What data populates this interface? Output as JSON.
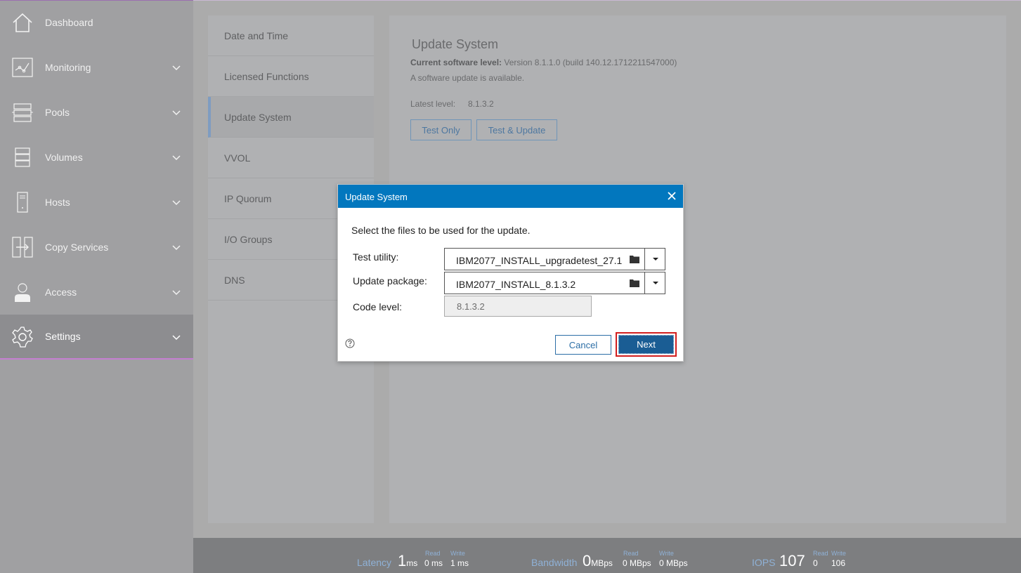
{
  "sidebar": {
    "items": [
      {
        "label": "Dashboard",
        "icon": "home-icon"
      },
      {
        "label": "Monitoring",
        "icon": "monitoring-icon"
      },
      {
        "label": "Pools",
        "icon": "pools-icon"
      },
      {
        "label": "Volumes",
        "icon": "volumes-icon"
      },
      {
        "label": "Hosts",
        "icon": "hosts-icon"
      },
      {
        "label": "Copy Services",
        "icon": "copy-services-icon"
      },
      {
        "label": "Access",
        "icon": "access-icon"
      },
      {
        "label": "Settings",
        "icon": "gear-icon",
        "active": true
      }
    ]
  },
  "settings_nav": {
    "items": [
      "Date and Time",
      "Licensed Functions",
      "Update System",
      "VVOL",
      "IP Quorum",
      "I/O Groups",
      "DNS"
    ],
    "active": "Update System"
  },
  "update_panel": {
    "title": "Update System",
    "current_label": "Current software level:",
    "current_value": "Version 8.1.1.0 (build 140.12.1712211547000)",
    "available_text": "A software update is available.",
    "latest_label": "Latest level:",
    "latest_value": "8.1.3.2",
    "test_only_label": "Test Only",
    "test_update_label": "Test & Update"
  },
  "dialog": {
    "title": "Update System",
    "prompt": "Select the files to be used for the update.",
    "test_utility_label": "Test utility:",
    "test_utility_value": "IBM2077_INSTALL_upgradetest_27.1",
    "update_package_label": "Update package:",
    "update_package_value": "IBM2077_INSTALL_8.1.3.2",
    "code_level_label": "Code level:",
    "code_level_value": "8.1.3.2",
    "cancel_label": "Cancel",
    "next_label": "Next"
  },
  "status": {
    "latency_label": "Latency",
    "latency_value": "1",
    "latency_unit": "ms",
    "latency_read_label": "Read",
    "latency_read": "0 ms",
    "latency_write_label": "Write",
    "latency_write": "1 ms",
    "bandwidth_label": "Bandwidth",
    "bandwidth_value": "0",
    "bandwidth_unit": "MBps",
    "bandwidth_read_label": "Read",
    "bandwidth_read": "0 MBps",
    "bandwidth_write_label": "Write",
    "bandwidth_write": "0 MBps",
    "iops_label": "IOPS",
    "iops_value": "107",
    "iops_read_label": "Read",
    "iops_read": "0",
    "iops_write_label": "Write",
    "iops_write": "106"
  },
  "colors": {
    "dialog_header": "#0277be",
    "next_button": "#1a5d94",
    "highlight_box": "#d21f1f"
  }
}
